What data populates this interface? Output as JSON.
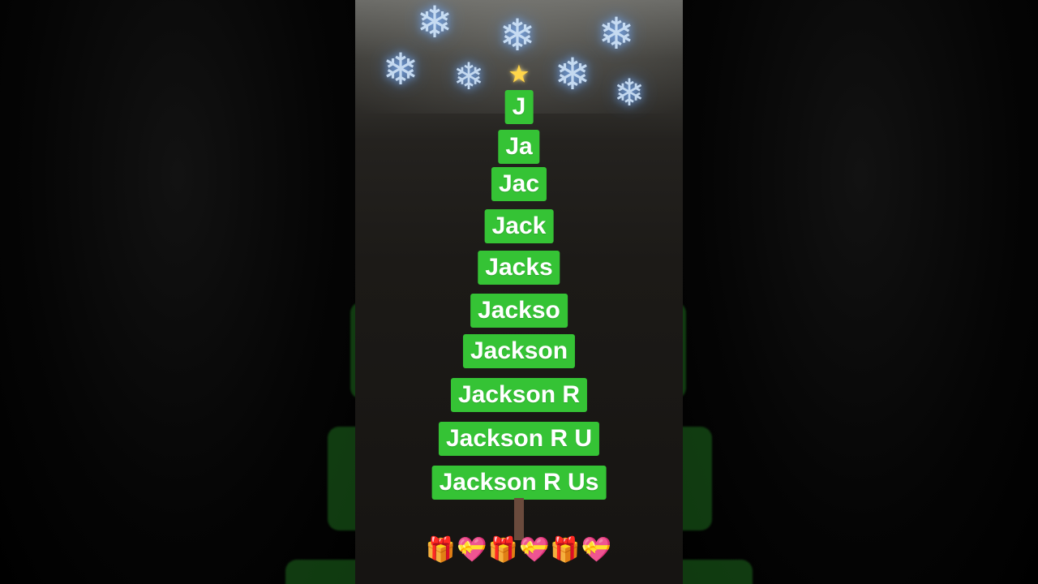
{
  "tree": {
    "star_icon": "star-icon",
    "rows": [
      "J",
      "Ja",
      "Jac",
      "Jack",
      "Jacks",
      "Jackso",
      "Jackson",
      "Jackson R",
      "Jackson R U",
      "Jackson R Us"
    ]
  },
  "decorations": {
    "gift_glyph": "🎁",
    "heart_glyph": "💝",
    "snowflake_glyph": "❄"
  },
  "colors": {
    "label_bg": "#35c335",
    "label_text": "#ffffff",
    "background": "#1c1a17"
  }
}
